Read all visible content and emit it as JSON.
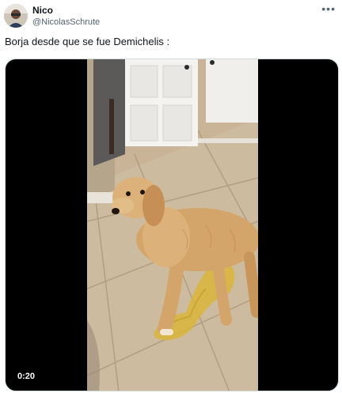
{
  "tweet": {
    "author_name": "Nico",
    "author_handle": "@NicolasSchrute",
    "more_icon": "more-horizontal-icon",
    "text": "Borja desde que se fue Demichelis :"
  },
  "media": {
    "type": "video",
    "timestamp": "0:20"
  }
}
